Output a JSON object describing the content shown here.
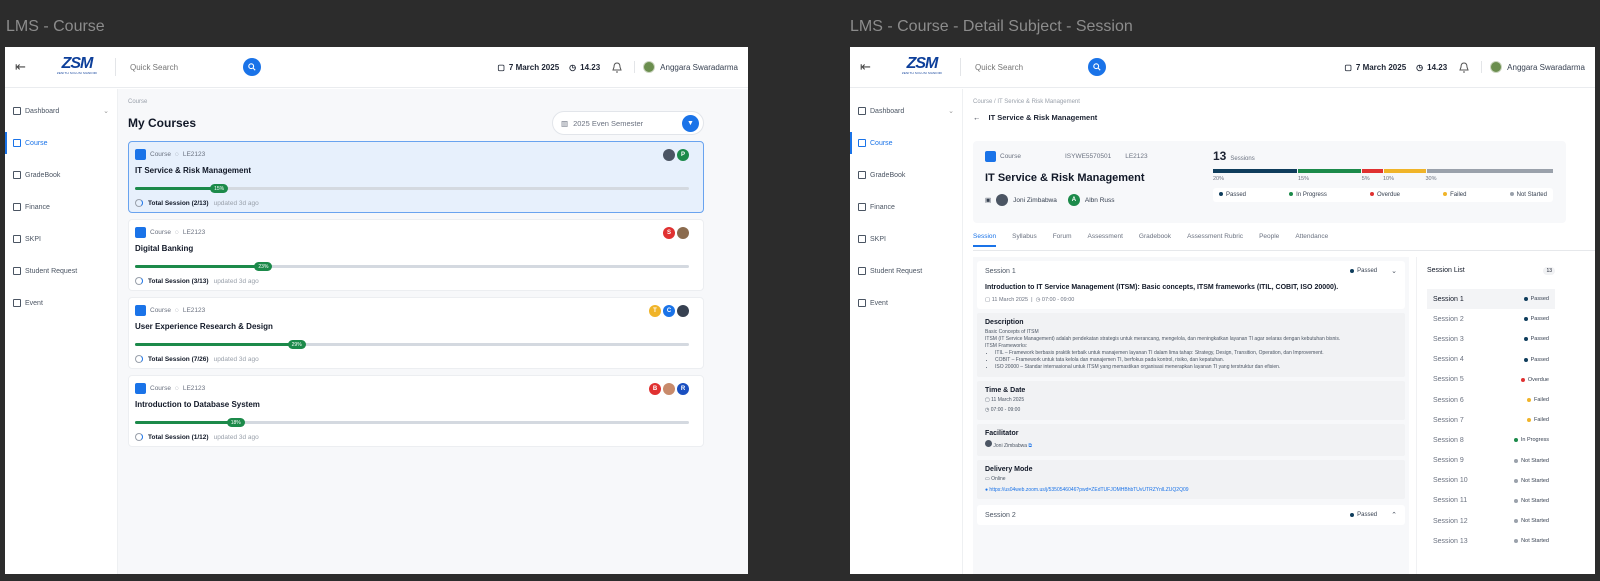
{
  "frame1": {
    "label": "LMS - Course",
    "breadcrumb": "Course",
    "title": "My Courses",
    "semester": "2025 Even Semester",
    "courses": [
      {
        "tag": "Course",
        "code": "LE2123",
        "title": "IT Service & Risk Management",
        "progress": 15,
        "progress_label": "15%",
        "sessions": "Total Session (2/13)",
        "updated": "updated 3d ago",
        "avatars": [
          {
            "t": "",
            "c": "#4b5563"
          },
          {
            "t": "P",
            "c": "#1c8a4a"
          }
        ]
      },
      {
        "tag": "Course",
        "code": "LE2123",
        "title": "Digital Banking",
        "progress": 23,
        "progress_label": "23%",
        "sessions": "Total Session (3/13)",
        "updated": "updated 3d ago",
        "avatars": [
          {
            "t": "S",
            "c": "#e03131"
          },
          {
            "t": "",
            "c": "#8b6b4e"
          }
        ]
      },
      {
        "tag": "Course",
        "code": "LE2123",
        "title": "User Experience Research & Design",
        "progress": 29,
        "progress_label": "29%",
        "sessions": "Total Session (7/26)",
        "updated": "updated 3d ago",
        "avatars": [
          {
            "t": "T",
            "c": "#f0b429"
          },
          {
            "t": "C",
            "c": "#1a73e8"
          },
          {
            "t": "",
            "c": "#374151"
          }
        ]
      },
      {
        "tag": "Course",
        "code": "LE2123",
        "title": "Introduction to Database System",
        "progress": 18,
        "progress_label": "18%",
        "sessions": "Total Session (1/12)",
        "updated": "updated 3d ago",
        "avatars": [
          {
            "t": "B",
            "c": "#e03131"
          },
          {
            "t": "",
            "c": "#c88a6b"
          },
          {
            "t": "R",
            "c": "#1a4fc0"
          }
        ]
      }
    ]
  },
  "frame2": {
    "label": "LMS - Course - Detail Subject - Session",
    "breadcrumb": "Course / IT Service & Risk Management",
    "back_title": "IT Service & Risk Management",
    "course_tag": "Course",
    "course_id": "ISYWE5570501",
    "course_code": "LE2123",
    "course_title": "IT Service & Risk Management",
    "lecturer1": "Joni Zimbabwa",
    "lecturer2": "Albn Russ",
    "session_count": "13",
    "session_word": "Sessions",
    "bars": [
      {
        "pct": 20,
        "label": "20%",
        "color": "#0f3d5c"
      },
      {
        "pct": 15,
        "label": "15%",
        "color": "#1c8a4a"
      },
      {
        "pct": 5,
        "label": "5%",
        "color": "#e03131"
      },
      {
        "pct": 10,
        "label": "10%",
        "color": "#f0b429"
      },
      {
        "pct": 30,
        "label": "30%",
        "color": "#9aa1ab"
      }
    ],
    "legend": [
      {
        "label": "Passed",
        "color": "#0f3d5c"
      },
      {
        "label": "In Progress",
        "color": "#1c8a4a"
      },
      {
        "label": "Overdue",
        "color": "#e03131"
      },
      {
        "label": "Failed",
        "color": "#f0b429"
      },
      {
        "label": "Not Started",
        "color": "#9aa1ab"
      }
    ],
    "tabs": [
      "Session",
      "Syllabus",
      "Forum",
      "Assessment",
      "Gradebook",
      "Assessment Rubric",
      "People",
      "Attendance"
    ],
    "session1": {
      "label": "Session 1",
      "status": "Passed",
      "title": "Introduction to IT Service Management (ITSM): Basic concepts, ITSM frameworks (ITIL, COBIT, ISO 20000).",
      "date": "11 March 2025",
      "time": "07:00 - 09:00",
      "desc_h": "Description",
      "desc_1": "Basic Concepts of ITSM",
      "desc_2": "ITSM (IT Service Management) adalah pendekatan strategis untuk merancang, mengelola, dan meningkatkan layanan TI agar selaras dengan kebutuhan bisnis.",
      "desc_3": "ITSM Frameworks:",
      "bullets": [
        "ITIL – Framework berbasis praktik terbaik untuk manajemen layanan TI dalam lima tahap: Strategy, Design, Transition, Operation, dan Improvement.",
        "COBIT – Framework untuk tata kelola dan manajemen TI, berfokus pada kontrol, risiko, dan kepatuhan.",
        "ISO 20000 – Standar internasional untuk ITSM yang memastikan organisasi menerapkan layanan TI yang terstruktur dan efisien."
      ],
      "td_h": "Time & Date",
      "fac_h": "Facilitator",
      "facilitator": "Joni Zimbabwa",
      "dm_h": "Delivery Mode",
      "mode": "Online",
      "link": "https://us04web.zoom.us/j/5350546046?pwd=ZEdTUFJOMHBhbTUvUTRZYnlLZUQ2Q09"
    },
    "session2": {
      "label": "Session 2",
      "status": "Passed"
    },
    "list_title": "Session List",
    "list_count": "13",
    "session_list": [
      {
        "name": "Session 1",
        "status": "Passed",
        "color": "#0f3d5c"
      },
      {
        "name": "Session 2",
        "status": "Passed",
        "color": "#0f3d5c"
      },
      {
        "name": "Session 3",
        "status": "Passed",
        "color": "#0f3d5c"
      },
      {
        "name": "Session 4",
        "status": "Passed",
        "color": "#0f3d5c"
      },
      {
        "name": "Session 5",
        "status": "Overdue",
        "color": "#e03131"
      },
      {
        "name": "Session 6",
        "status": "Failed",
        "color": "#f0b429"
      },
      {
        "name": "Session 7",
        "status": "Failed",
        "color": "#f0b429"
      },
      {
        "name": "Session 8",
        "status": "In Progress",
        "color": "#1c8a4a"
      },
      {
        "name": "Session 9",
        "status": "Not Started",
        "color": "#9aa1ab"
      },
      {
        "name": "Session 10",
        "status": "Not Started",
        "color": "#9aa1ab"
      },
      {
        "name": "Session 11",
        "status": "Not Started",
        "color": "#9aa1ab"
      },
      {
        "name": "Session 12",
        "status": "Not Started",
        "color": "#9aa1ab"
      },
      {
        "name": "Session 13",
        "status": "Not Started",
        "color": "#9aa1ab"
      }
    ]
  },
  "topbar": {
    "search_placeholder": "Quick Search",
    "date": "7 March 2025",
    "time": "14.23",
    "user": "Anggara Swaradarma",
    "logo": "ZSM",
    "logo_sub": "ZENITH SOLUSI MANDIRI"
  },
  "sidebar": [
    "Dashboard",
    "Course",
    "GradeBook",
    "Finance",
    "SKPI",
    "Student Request",
    "Event"
  ]
}
